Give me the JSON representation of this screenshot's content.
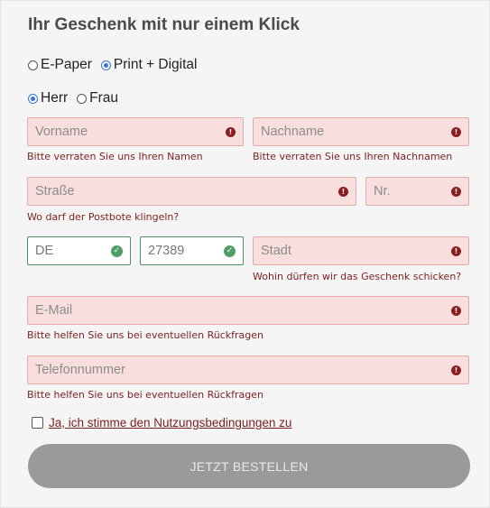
{
  "form": {
    "title": "Ihr Geschenk mit nur einem Klick",
    "edition": {
      "options": [
        {
          "label": "E-Paper",
          "checked": false
        },
        {
          "label": "Print + Digital",
          "checked": true
        }
      ]
    },
    "salutation": {
      "options": [
        {
          "label": "Herr",
          "checked": true
        },
        {
          "label": "Frau",
          "checked": false
        }
      ]
    },
    "fields": {
      "vorname": {
        "placeholder": "Vorname",
        "hint": "Bitte verraten Sie uns Ihren Namen",
        "status": "error"
      },
      "nachname": {
        "placeholder": "Nachname",
        "hint": "Bitte verraten Sie uns Ihren Nachnamen",
        "status": "error"
      },
      "strasse": {
        "placeholder": "Straße",
        "hint": "Wo darf der Postbote klingeln?",
        "status": "error"
      },
      "nr": {
        "placeholder": "Nr.",
        "status": "error"
      },
      "land": {
        "value": "DE",
        "status": "valid"
      },
      "plz": {
        "value": "27389",
        "status": "valid"
      },
      "stadt": {
        "placeholder": "Stadt",
        "hint": "Wohin dürfen wir das Geschenk schicken?",
        "status": "error"
      },
      "email": {
        "placeholder": "E-Mail",
        "hint": "Bitte helfen Sie uns bei eventuellen Rückfragen",
        "status": "error"
      },
      "telefon": {
        "placeholder": "Telefonnummer",
        "hint": "Bitte helfen Sie uns bei eventuellen Rückfragen",
        "status": "error"
      }
    },
    "consent": {
      "label": "Ja, ich stimme den Nutzungsbedingungen zu",
      "checked": false
    },
    "submit_label": "JETZT BESTELLEN"
  },
  "icons": {
    "error": "exclamation-circle-icon",
    "valid": "check-circle-icon"
  },
  "colors": {
    "error_border": "#e6a8a8",
    "error_bg": "#f9dede",
    "error_text": "#7a1f1f",
    "valid_border": "#4f8f63",
    "button_bg": "#9a9a9a",
    "radio_accent": "#3b73d6"
  }
}
